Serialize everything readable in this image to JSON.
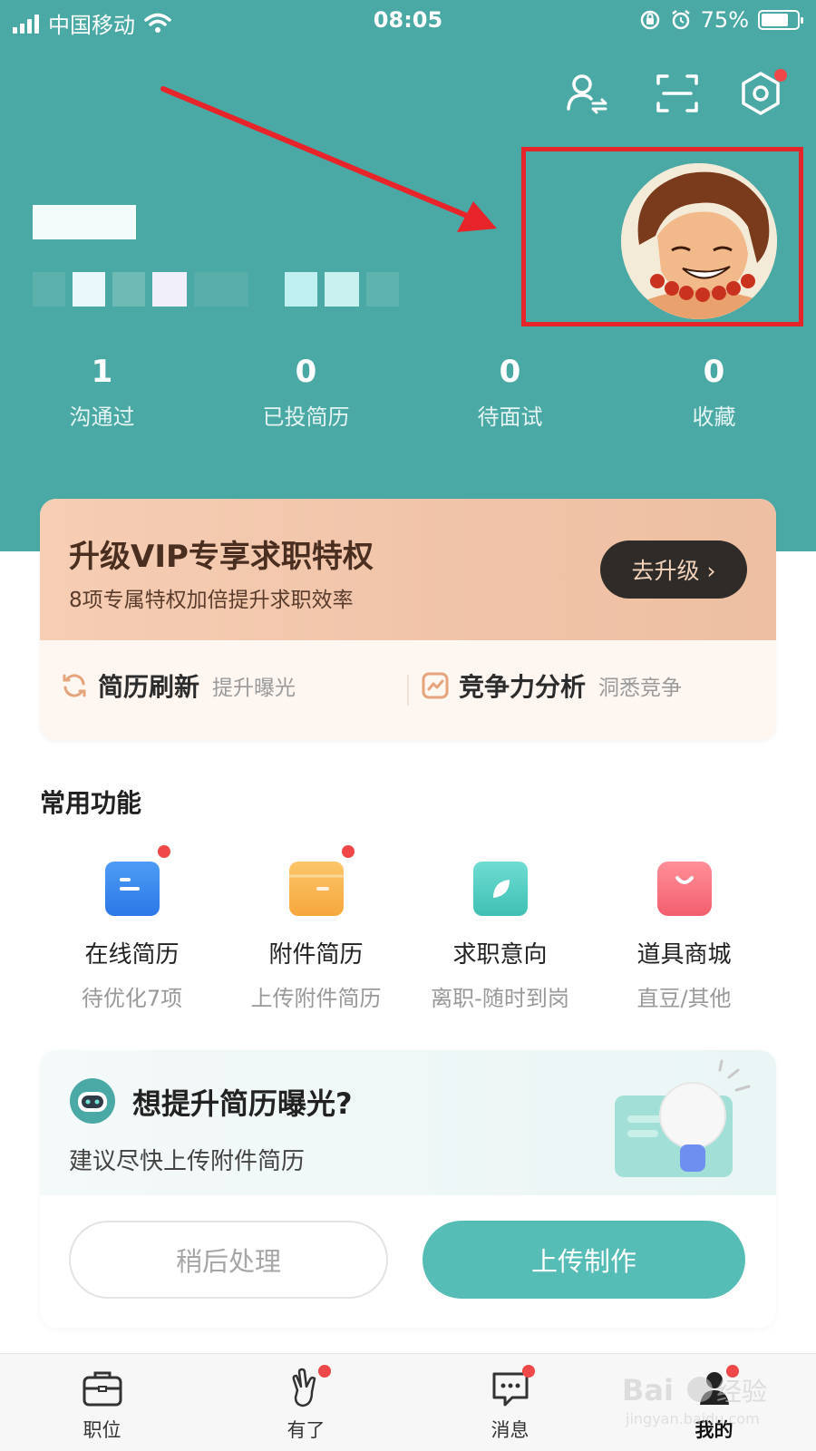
{
  "status_bar": {
    "carrier": "中国移动",
    "time": "08:05",
    "battery": "75%",
    "battery_level": 0.75
  },
  "profile": {
    "stats": [
      {
        "value": "1",
        "label": "沟通过"
      },
      {
        "value": "0",
        "label": "已投简历"
      },
      {
        "value": "0",
        "label": "待面试"
      },
      {
        "value": "0",
        "label": "收藏"
      }
    ]
  },
  "vip": {
    "title": "升级VIP专享求职特权",
    "subtitle": "8项专属特权加倍提升求职效率",
    "button": "去升级 ›",
    "features": [
      {
        "name": "简历刷新",
        "desc": "提升曝光"
      },
      {
        "name": "竞争力分析",
        "desc": "洞悉竞争"
      }
    ]
  },
  "common": {
    "title": "常用功能",
    "items": [
      {
        "label": "在线简历",
        "sub": "待优化7项"
      },
      {
        "label": "附件简历",
        "sub": "上传附件简历"
      },
      {
        "label": "求职意向",
        "sub": "离职-随时到岗"
      },
      {
        "label": "道具商城",
        "sub": "直豆/其他"
      }
    ]
  },
  "suggestion": {
    "title": "想提升简历曝光?",
    "subtitle": "建议尽快上传附件简历",
    "later_button": "稍后处理",
    "upload_button": "上传制作"
  },
  "tabbar": {
    "tabs": [
      {
        "label": "职位"
      },
      {
        "label": "有了"
      },
      {
        "label": "消息"
      },
      {
        "label": "我的"
      }
    ]
  },
  "colors": {
    "header_teal": "#4aa9a4",
    "accent_teal": "#55bdb5",
    "badge_red": "#f04848",
    "highlight_red": "#e8242b"
  },
  "icons": {
    "top": [
      "switch-identity-icon",
      "scan-icon",
      "settings-icon"
    ],
    "vip": [
      "refresh-icon",
      "trend-chart-icon"
    ],
    "common": [
      "resume-doc-icon",
      "folder-icon",
      "leaf-icon",
      "shopping-bag-icon"
    ],
    "tabs": [
      "briefcase-icon",
      "hand-gesture-icon",
      "chat-bubble-icon",
      "profile-icon"
    ]
  }
}
